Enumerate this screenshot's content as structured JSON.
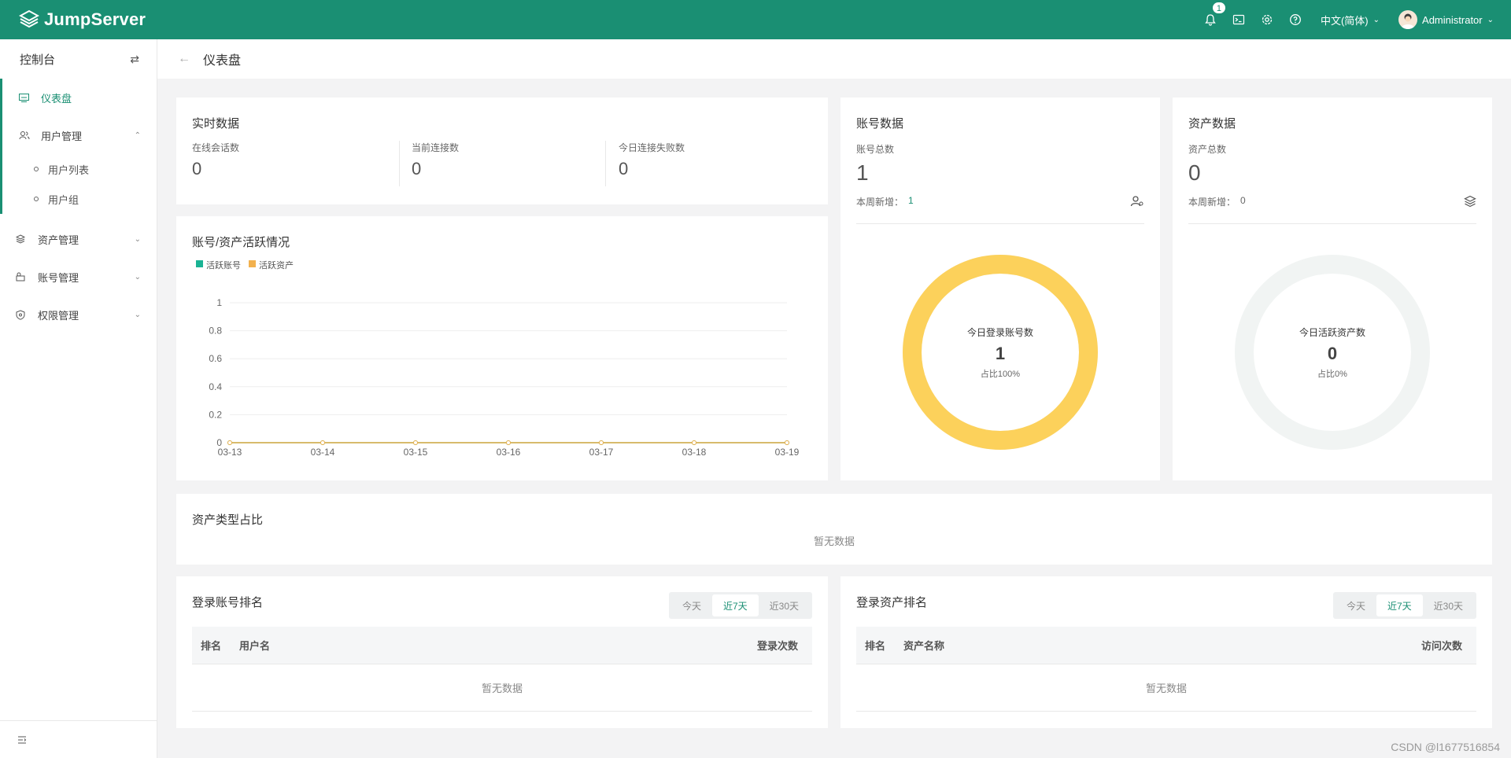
{
  "app": {
    "name": "JumpServer"
  },
  "topbar": {
    "notification_count": "1",
    "language": "中文(简体)",
    "user": "Administrator"
  },
  "sidebar": {
    "title": "控制台",
    "items": [
      {
        "label": "仪表盘"
      },
      {
        "label": "用户管理",
        "children": [
          {
            "label": "用户列表"
          },
          {
            "label": "用户组"
          }
        ]
      },
      {
        "label": "资产管理"
      },
      {
        "label": "账号管理"
      },
      {
        "label": "权限管理"
      }
    ]
  },
  "page": {
    "title": "仪表盘"
  },
  "realtime": {
    "title": "实时数据",
    "stats": [
      {
        "label": "在线会话数",
        "value": "0"
      },
      {
        "label": "当前连接数",
        "value": "0"
      },
      {
        "label": "今日连接失败数",
        "value": "0"
      }
    ]
  },
  "activity": {
    "title": "账号/资产活跃情况",
    "legend": [
      {
        "name": "活跃账号",
        "color": "#1ab394"
      },
      {
        "name": "活跃资产",
        "color": "#f2b14e"
      }
    ]
  },
  "chart_data": {
    "type": "line",
    "x": [
      "03-13",
      "03-14",
      "03-15",
      "03-16",
      "03-17",
      "03-18",
      "03-19"
    ],
    "series": [
      {
        "name": "活跃账号",
        "values": [
          0,
          0,
          0,
          0,
          0,
          0,
          0
        ]
      },
      {
        "name": "活跃资产",
        "values": [
          0,
          0,
          0,
          0,
          0,
          0,
          0
        ]
      }
    ],
    "yticks": [
      "0",
      "0.2",
      "0.4",
      "0.6",
      "0.8",
      "1"
    ],
    "ylim": [
      0,
      1
    ],
    "grid": true,
    "legend": "top-left"
  },
  "accounts": {
    "title": "账号数据",
    "total_label": "账号总数",
    "total": "1",
    "week_label": "本周新增：",
    "week_value": "1",
    "ring": {
      "label": "今日登录账号数",
      "value": "1",
      "ratio": "占比100%",
      "fraction": 1.0
    }
  },
  "assets": {
    "title": "资产数据",
    "total_label": "资产总数",
    "total": "0",
    "week_label": "本周新增：",
    "week_value": "0",
    "ring": {
      "label": "今日活跃资产数",
      "value": "0",
      "ratio": "占比0%",
      "fraction": 0
    }
  },
  "asset_types": {
    "title": "资产类型占比",
    "empty": "暂无数据"
  },
  "login_users": {
    "title": "登录账号排名",
    "tabs": [
      "今天",
      "近7天",
      "近30天"
    ],
    "active_tab": "近7天",
    "columns": [
      "排名",
      "用户名",
      "登录次数"
    ],
    "empty": "暂无数据"
  },
  "login_assets": {
    "title": "登录资产排名",
    "tabs": [
      "今天",
      "近7天",
      "近30天"
    ],
    "active_tab": "近7天",
    "columns": [
      "排名",
      "资产名称",
      "访问次数"
    ],
    "empty": "暂无数据"
  },
  "watermark": "CSDN @l1677516854",
  "colors": {
    "brand": "#1a8f73",
    "ring_accounts": "#fcd15b",
    "ring_empty": "#f1f4f3"
  }
}
